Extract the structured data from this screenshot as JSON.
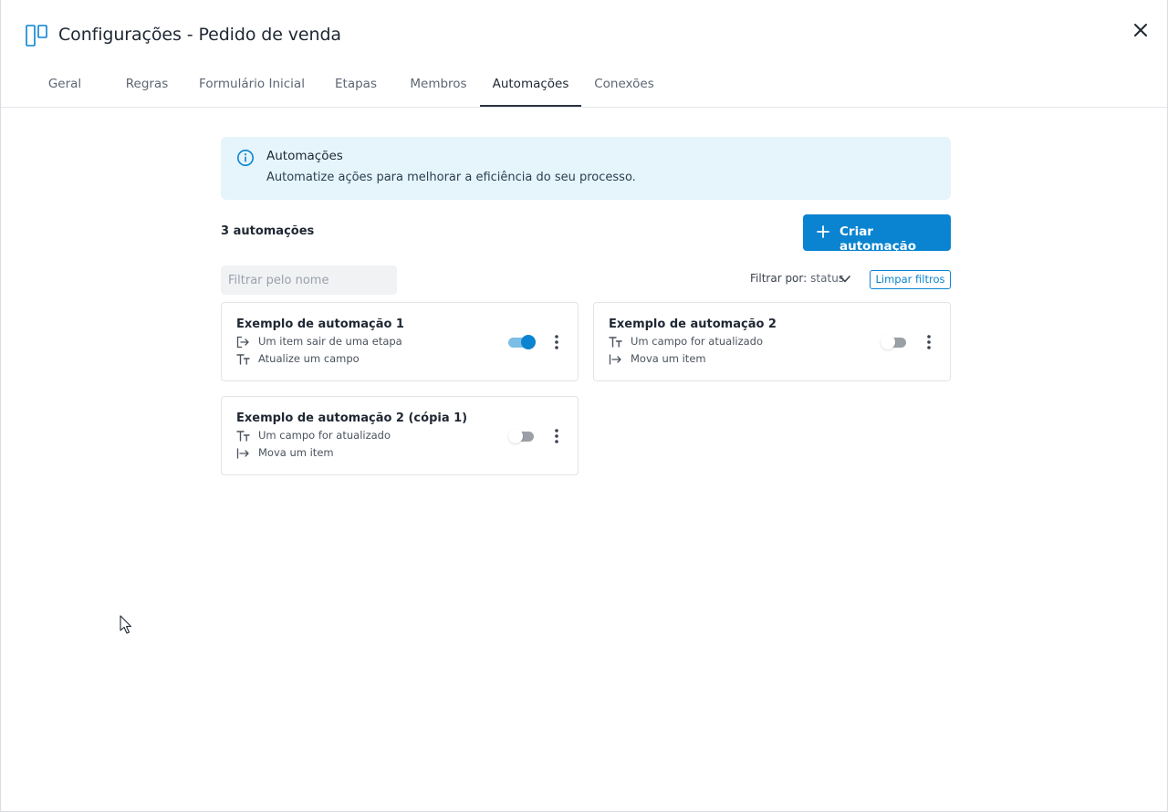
{
  "header": {
    "title": "Configurações - Pedido de venda"
  },
  "tabs": [
    {
      "label": "Geral",
      "active": false
    },
    {
      "label": "Regras",
      "active": false
    },
    {
      "label": "Formulário Inicial",
      "active": false
    },
    {
      "label": "Etapas",
      "active": false
    },
    {
      "label": "Membros",
      "active": false
    },
    {
      "label": "Automações",
      "active": true
    },
    {
      "label": "Conexões",
      "active": false
    }
  ],
  "banner": {
    "title": "Automações",
    "text": "Automatize ações para melhorar a eficiência do seu processo."
  },
  "list": {
    "count_label": "3 automações",
    "create_label": "Criar automação",
    "search_placeholder": "Filtrar pelo nome",
    "filter_label": "Filtrar por:",
    "filter_value": "status",
    "clear_label": "Limpar filtros"
  },
  "automations": [
    {
      "name": "Exemplo de automação 1",
      "trigger": {
        "icon": "exit-stage-icon",
        "text": "Um item sair de uma etapa"
      },
      "action": {
        "icon": "text-field-icon",
        "text": "Atualize um campo"
      },
      "enabled": true
    },
    {
      "name": "Exemplo de automação 2",
      "trigger": {
        "icon": "text-field-icon",
        "text": "Um campo for atualizado"
      },
      "action": {
        "icon": "move-item-icon",
        "text": "Mova um item"
      },
      "enabled": false
    },
    {
      "name": "Exemplo de automação 2 (cópia 1)",
      "trigger": {
        "icon": "text-field-icon",
        "text": "Um campo for atualizado"
      },
      "action": {
        "icon": "move-item-icon",
        "text": "Mova um item"
      },
      "enabled": false
    }
  ],
  "colors": {
    "accent": "#0a84d0",
    "banner_bg": "#e5f5fb",
    "text": "#1f2733"
  }
}
